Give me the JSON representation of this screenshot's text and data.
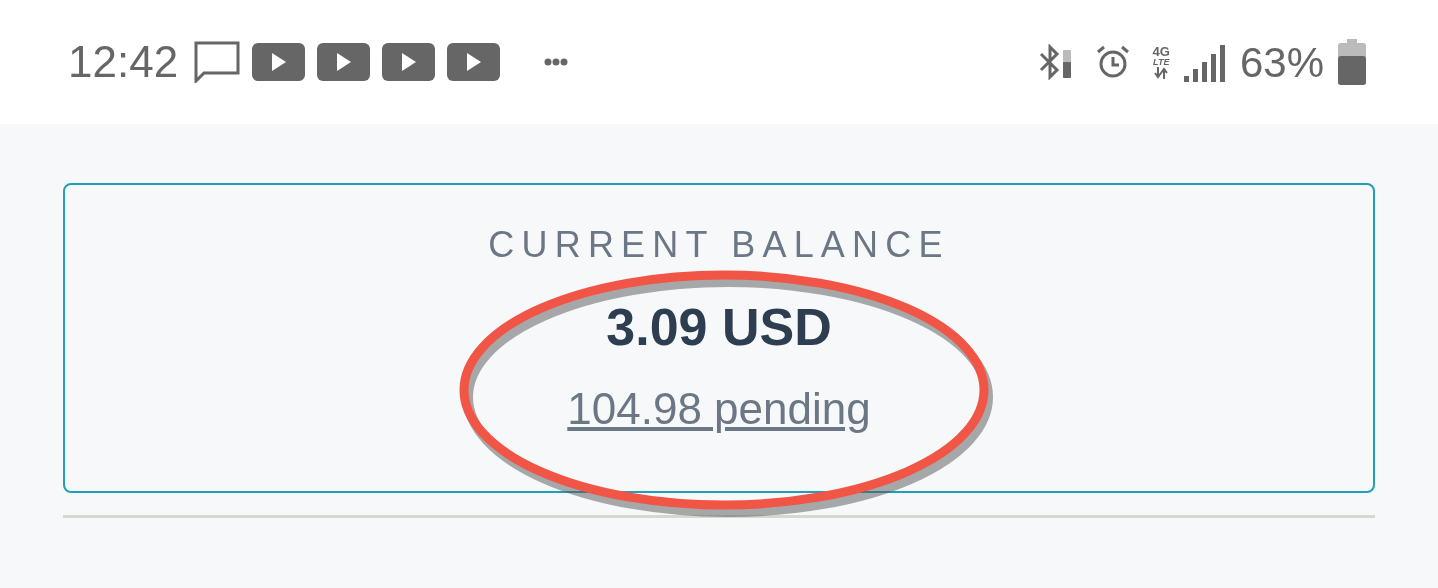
{
  "status_bar": {
    "time": "12:42",
    "notification_icons": [
      {
        "kind": "message"
      },
      {
        "kind": "video"
      },
      {
        "kind": "video"
      },
      {
        "kind": "video"
      },
      {
        "kind": "video"
      },
      {
        "kind": "more"
      }
    ],
    "network_type": [
      "4G",
      "LTE"
    ],
    "battery_percent": "63%"
  },
  "balance_card": {
    "label": "CURRENT BALANCE",
    "amount": "3.09 USD",
    "pending": "104.98 pending",
    "highlighted": true
  }
}
